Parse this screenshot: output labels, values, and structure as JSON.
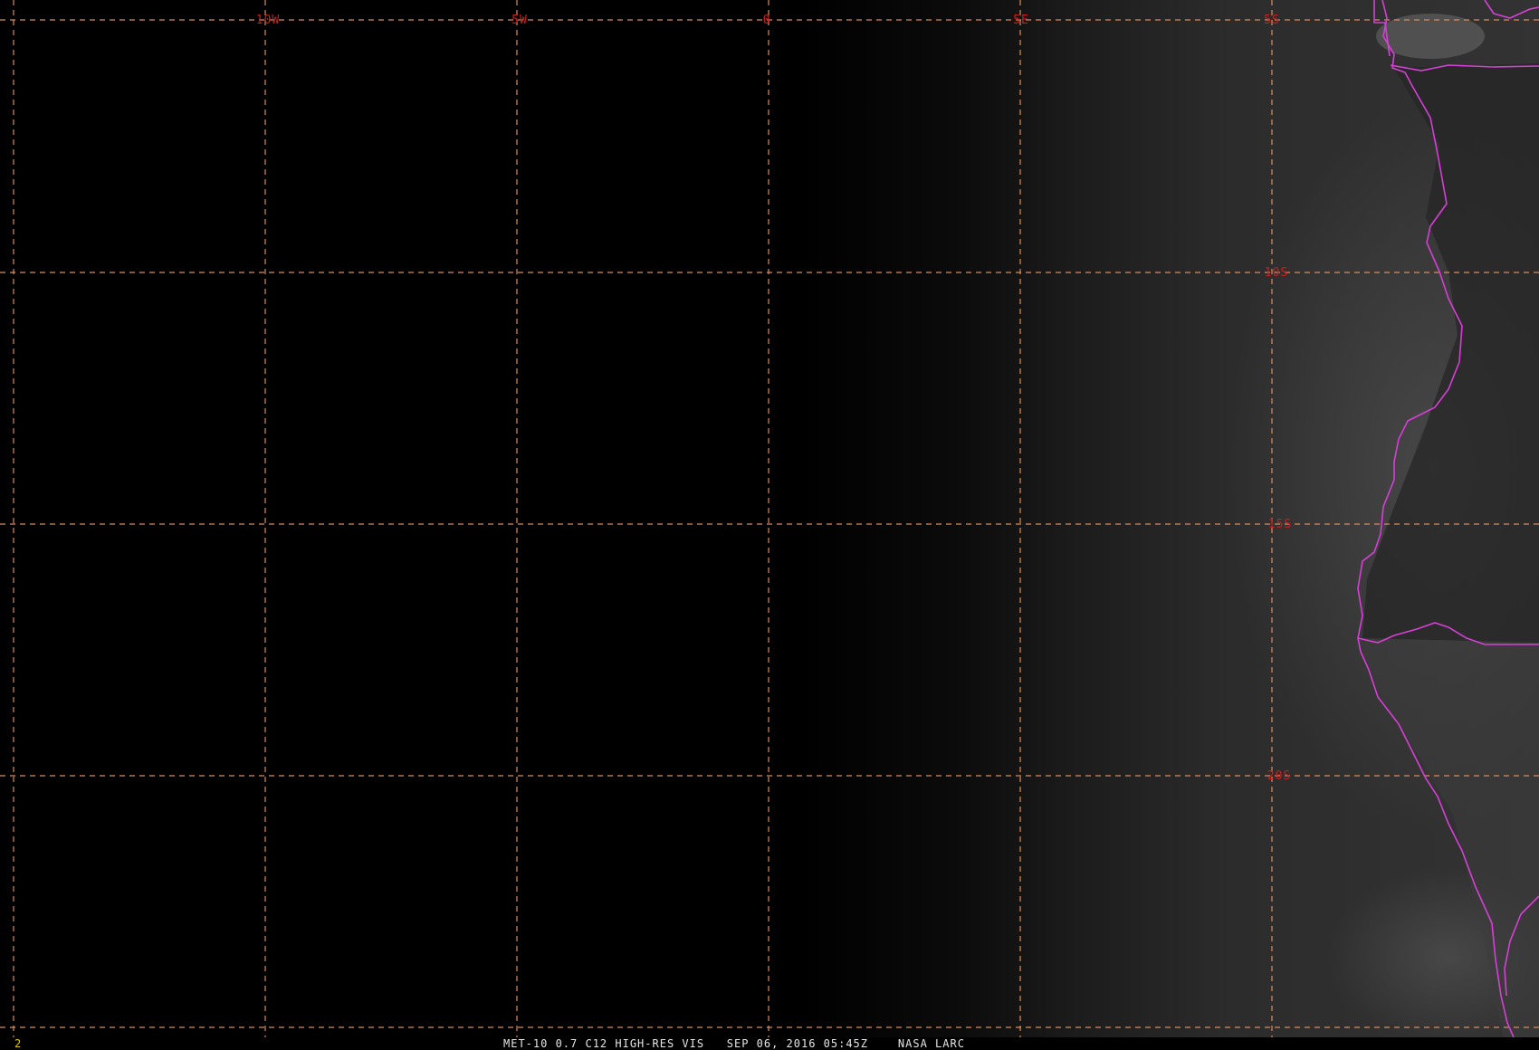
{
  "colors": {
    "background": "#000000",
    "graticule": "#d98c5f",
    "grid_label": "#cc1e1e",
    "coastline": "#d640d6",
    "footer_text": "#e6e6e6",
    "frame_number": "#e6c800"
  },
  "grid_labels": {
    "lon_10w": "10W",
    "lon_5w": "5W",
    "lon_0": "0",
    "lon_5e": "5E",
    "lat_5s": "5S",
    "lat_10s": "10S",
    "lat_15s": "15S",
    "lat_20s": "20S"
  },
  "footer": {
    "frame_number": "2",
    "caption": "MET-10 0.7 C12 HIGH-RES VIS   SEP 06, 2016 05:45Z    NASA LARC"
  }
}
